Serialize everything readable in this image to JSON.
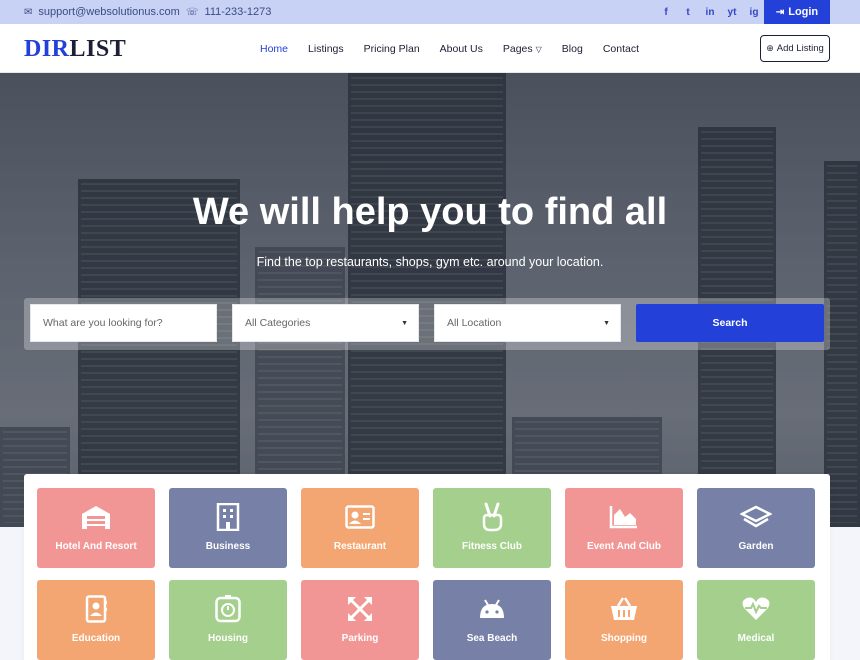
{
  "topbar": {
    "email": "support@websolutionus.com",
    "phone": "111-233-1273",
    "social": [
      "f",
      "t",
      "in",
      "yt",
      "ig"
    ],
    "login_label": "Login"
  },
  "header": {
    "logo_part1": "DIR",
    "logo_part2": "LIST",
    "nav": [
      {
        "label": "Home",
        "active": true
      },
      {
        "label": "Listings"
      },
      {
        "label": "Pricing Plan"
      },
      {
        "label": "About Us"
      },
      {
        "label": "Pages"
      },
      {
        "label": "Blog"
      },
      {
        "label": "Contact"
      }
    ],
    "add_listing_label": "Add Listing"
  },
  "hero": {
    "title": "We will help you to find all",
    "subtitle": "Find the top restaurants, shops, gym etc. around your location.",
    "search": {
      "what_placeholder": "What are you looking for?",
      "category_value": "All Categories",
      "location_value": "All Location",
      "button_label": "Search"
    }
  },
  "categories": [
    {
      "label": "Hotel And Resort",
      "icon": "garage-icon",
      "color": "#f19694"
    },
    {
      "label": "Business",
      "icon": "building-icon",
      "color": "#7780a6"
    },
    {
      "label": "Restaurant",
      "icon": "id-card-icon",
      "color": "#f3a672"
    },
    {
      "label": "Fitness Club",
      "icon": "peace-hand-icon",
      "color": "#a4cf8d"
    },
    {
      "label": "Event And Club",
      "icon": "chart-area-icon",
      "color": "#f19694"
    },
    {
      "label": "Garden",
      "icon": "layers-icon",
      "color": "#7780a6"
    },
    {
      "label": "Education",
      "icon": "address-book-icon",
      "color": "#f3a672"
    },
    {
      "label": "Housing",
      "icon": "stopwatch-icon",
      "color": "#a4cf8d"
    },
    {
      "label": "Parking",
      "icon": "arrows-expand-icon",
      "color": "#f19694"
    },
    {
      "label": "Sea Beach",
      "icon": "android-icon",
      "color": "#7780a6"
    },
    {
      "label": "Shopping",
      "icon": "basket-icon",
      "color": "#f3a672"
    },
    {
      "label": "Medical",
      "icon": "heartbeat-icon",
      "color": "#a4cf8d"
    }
  ]
}
